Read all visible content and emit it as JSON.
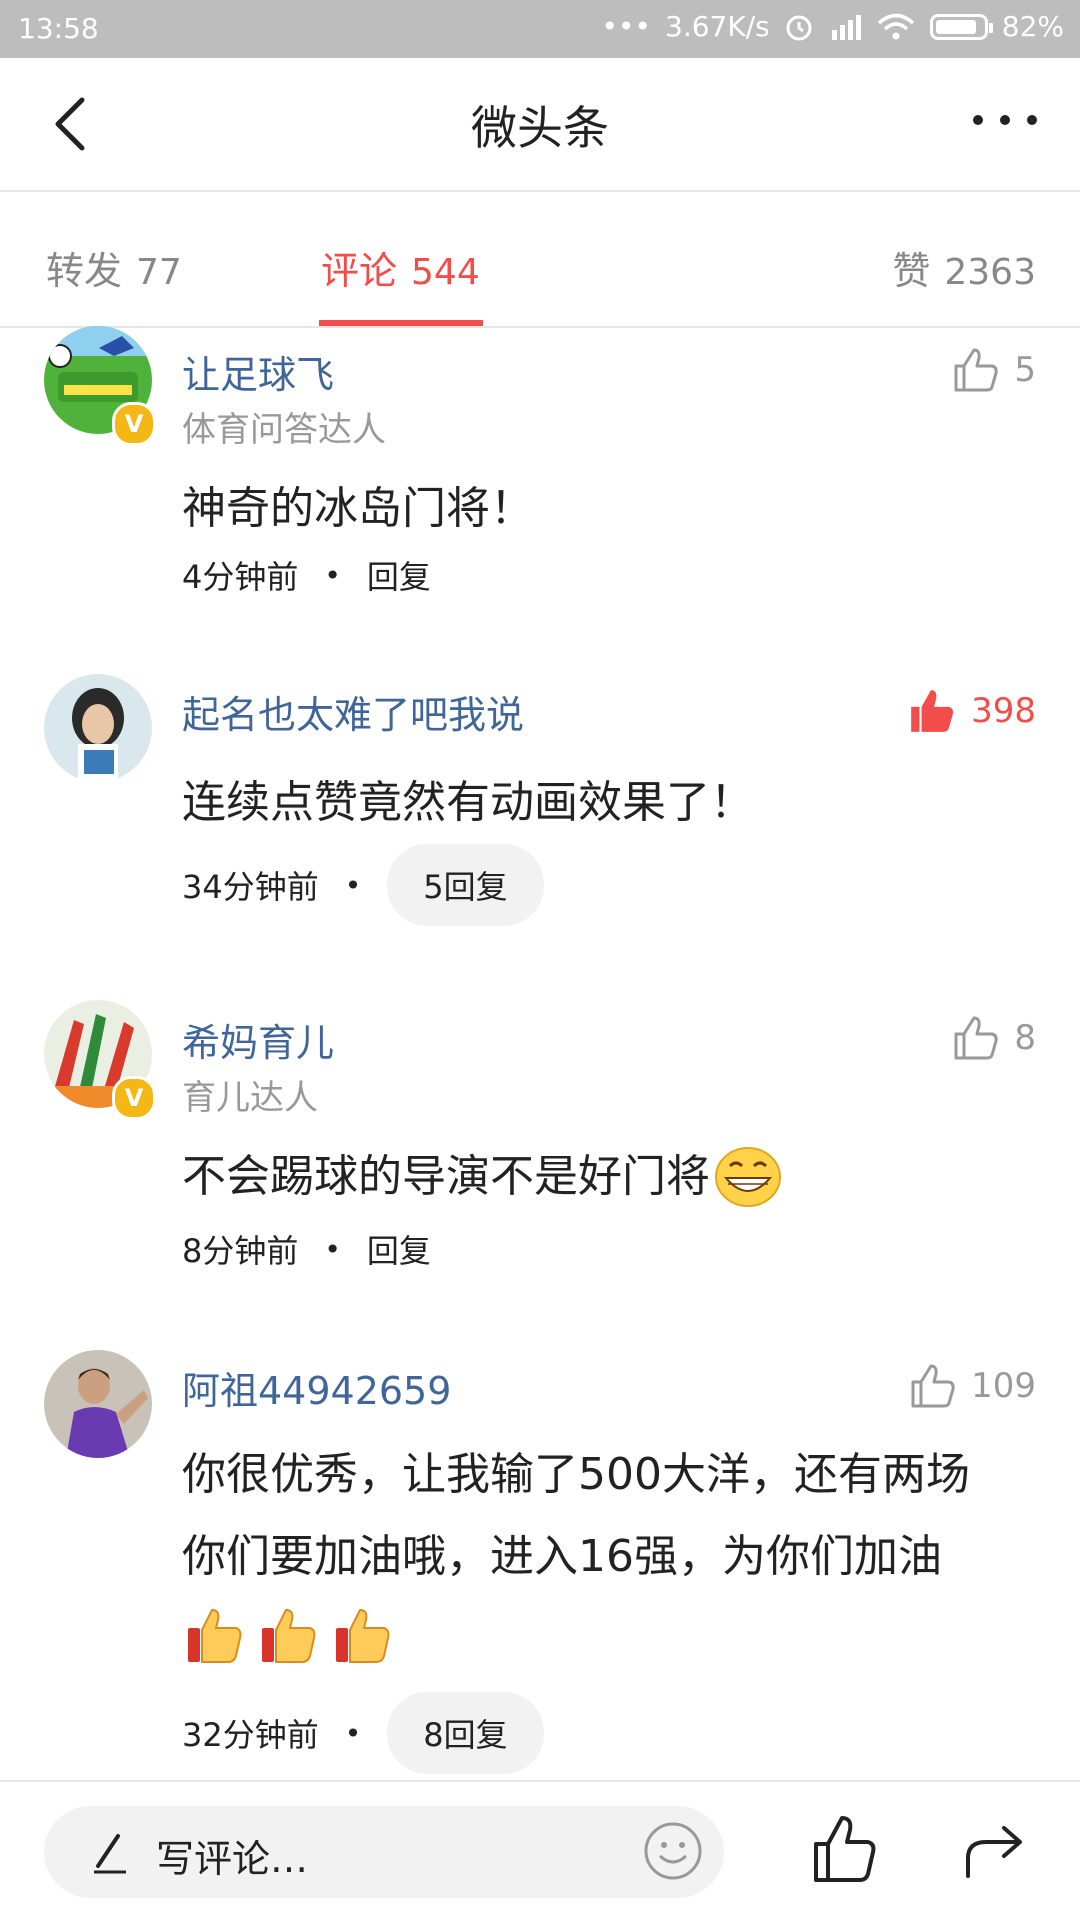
{
  "status_bar": {
    "time": "13:58",
    "dots": "•••",
    "speed": "3.67K/s",
    "battery_pct": "82%"
  },
  "nav": {
    "title": "微头条"
  },
  "tabs": [
    {
      "label": "转发",
      "count": "77"
    },
    {
      "label": "评论",
      "count": "544",
      "active": true
    },
    {
      "label": "赞",
      "count": "2363"
    }
  ],
  "comments": [
    {
      "name": "让足球飞",
      "subtitle": "体育问答达人",
      "verified": true,
      "likes": "5",
      "liked": false,
      "text": "神奇的冰岛门将！",
      "time": "4分钟前",
      "reply": "回复"
    },
    {
      "name": "起名也太难了吧我说",
      "likes": "398",
      "liked": true,
      "text": "连续点赞竟然有动画效果了！",
      "time": "34分钟前",
      "reply": "5回复"
    },
    {
      "name": "希妈育儿",
      "subtitle": "育儿达人",
      "verified": true,
      "likes": "8",
      "liked": false,
      "text": "不会踢球的导演不是好门将",
      "time": "8分钟前",
      "reply": "回复"
    },
    {
      "name": "阿祖44942659",
      "likes": "109",
      "liked": false,
      "text_line1": "你很优秀，让我输了500大洋，还有两场",
      "text_line2": "你们要加油哦，进入16强，为你们加油",
      "time": "32分钟前",
      "reply": "8回复"
    }
  ],
  "bottom": {
    "placeholder": "写评论…"
  },
  "colors": {
    "accent": "#f24d4a",
    "username": "#406599",
    "muted": "#999999"
  }
}
